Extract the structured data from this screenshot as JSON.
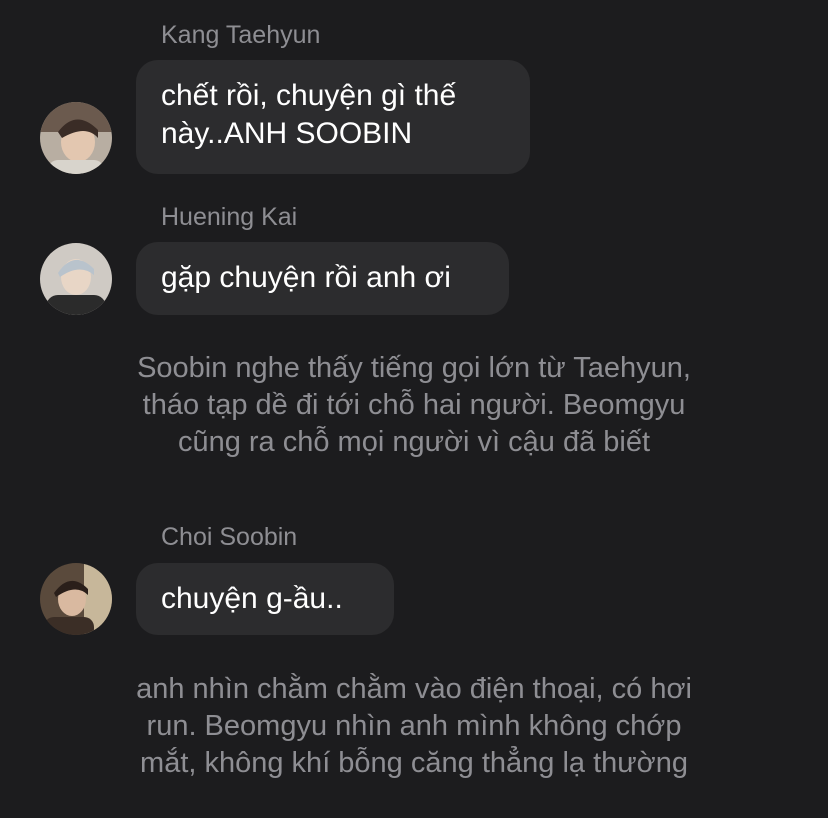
{
  "messages": [
    {
      "sender": "Kang Taehyun",
      "text_lines": [
        "chết rồi, chuyện gì thế",
        "này..ANH SOOBIN"
      ],
      "avatar_icon": "user-avatar-photo"
    },
    {
      "sender": "Huening Kai",
      "text_lines": [
        "gặp chuyện rồi anh ơi"
      ],
      "avatar_icon": "user-avatar-photo"
    },
    {
      "sender": "Choi Soobin",
      "text_lines": [
        "chuyện g-ầu.."
      ],
      "avatar_icon": "user-avatar-photo"
    }
  ],
  "narrations": [
    {
      "lines": [
        "Soobin nghe thấy tiếng gọi lớn từ Taehyun,",
        "tháo tạp dề đi tới chỗ hai người. Beomgyu",
        "cũng ra chỗ mọi người vì cậu đã biết"
      ]
    },
    {
      "lines": [
        "anh nhìn chằm chằm vào điện thoại, có hơi",
        "run. Beomgyu nhìn anh mình không chớp",
        "mắt, không khí bỗng căng thẳng lạ thường"
      ]
    }
  ],
  "colors": {
    "background": "#1c1c1e",
    "bubble": "#2c2c2e",
    "message_text": "#ffffff",
    "secondary_text": "#8e8e93"
  }
}
